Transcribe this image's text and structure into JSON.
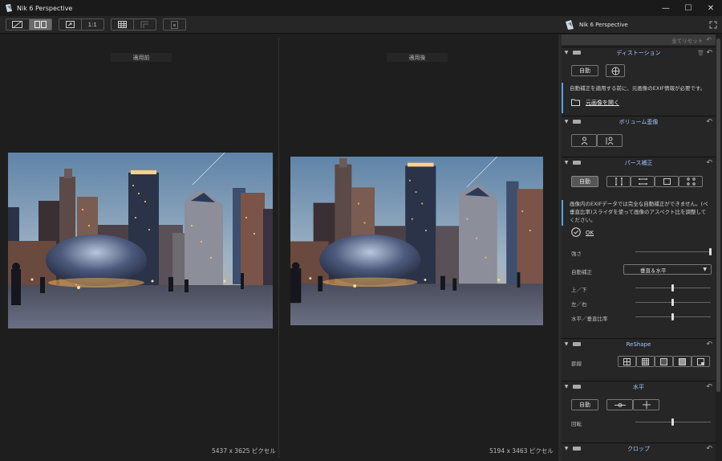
{
  "window": {
    "title": "Nik 6 Perspective",
    "minimize": "—",
    "maximize": "☐",
    "close": "✕"
  },
  "toolbar": {
    "zoom_label": "1:1"
  },
  "panel_header": {
    "title": "Nik 6 Perspective"
  },
  "canvas": {
    "before_label": "適用前",
    "after_label": "適用後",
    "before_dims": "5437 x 3625 ピクセル",
    "after_dims": "5194 x 3463 ピクセル"
  },
  "panel": {
    "reset_all": "全てリセット",
    "distortion": {
      "title": "ディストーション",
      "auto_button": "自動",
      "info": "自動補正を適用する前に、元画像のEXIF情報が必要です。",
      "open_link": "元画像を開く"
    },
    "volume": {
      "title": "ボリューム歪像"
    },
    "perspective": {
      "title": "パース補正",
      "auto_button": "自動",
      "info": "画像内のEXIFデータでは完全な自動補正ができません。(ペ垂直比率)スライダを使って画像のアスペクト比を調整してください。",
      "ok": "OK",
      "strength_label": "強さ",
      "strength": 1.0,
      "autofix_label": "自動補正",
      "autofix_value": "垂直＆水平",
      "vertical_label": "上／下",
      "vertical": 0.5,
      "horizontal_label": "左／右",
      "horizontal": 0.5,
      "aspect_label": "水平／垂直比率",
      "aspect": 0.5
    },
    "reshape": {
      "title": "ReShape",
      "grid_label": "罫線"
    },
    "level": {
      "title": "水平",
      "auto_button": "自動",
      "rotate_label": "回転",
      "rotate": 0.5
    },
    "crop": {
      "title": "クロップ"
    }
  },
  "colors": {
    "accent": "#9fc7ff",
    "info_bar": "#5aa0e0"
  }
}
